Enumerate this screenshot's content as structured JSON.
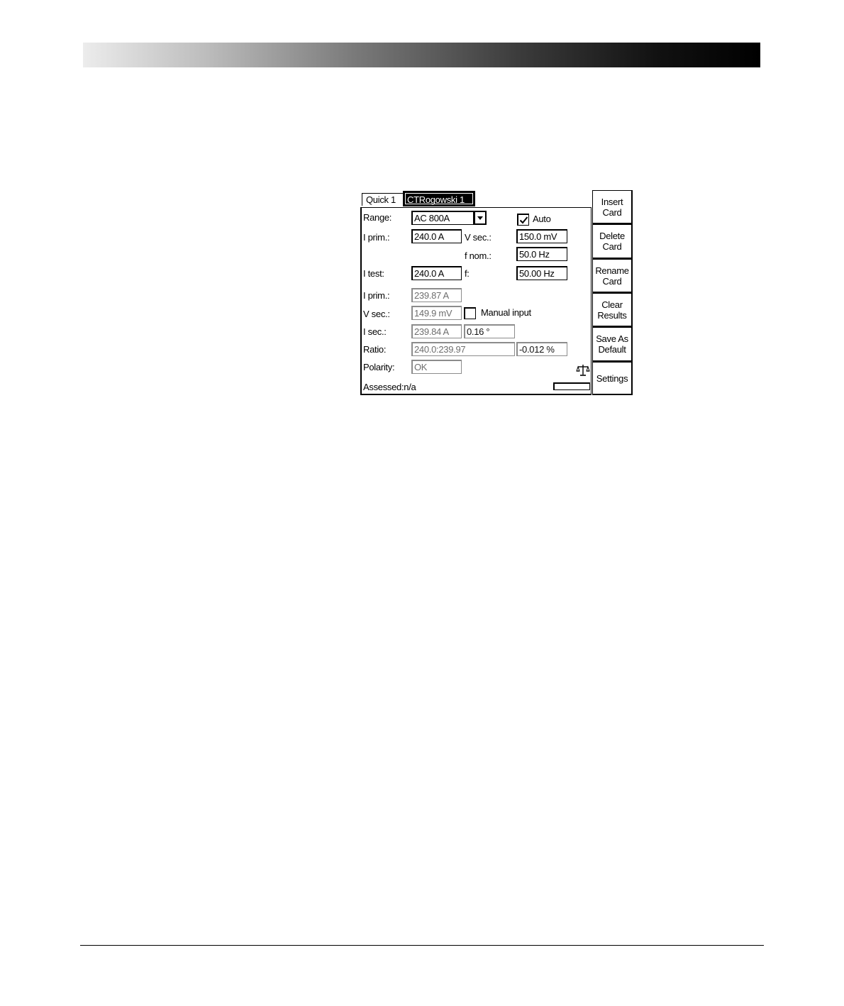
{
  "tabs": [
    {
      "label": "Quick 1",
      "active": false
    },
    {
      "label": "CTRogowski 1",
      "active": true
    }
  ],
  "form": {
    "range_label": "Range:",
    "range_value": "AC 800A",
    "auto_label": "Auto",
    "auto_checked": true,
    "iprim_label": "I prim.:",
    "iprim_value": "240.0 A",
    "vsec_label": "V sec.:",
    "vsec_value": "150.0 mV",
    "fnom_label": "f nom.:",
    "fnom_value": "50.0 Hz",
    "itest_label": "I test:",
    "itest_value": "240.0 A",
    "f_label": "f:",
    "f_value": "50.00 Hz"
  },
  "results": {
    "iprim_label": "I prim.:",
    "iprim_value": "239.87 A",
    "vsec_label": "V sec.:",
    "vsec_value": "149.9 mV",
    "manual_label": "Manual input",
    "manual_checked": false,
    "isec_label": "I sec.:",
    "isec_value": "239.84 A",
    "isec_phase": "0.16 °",
    "ratio_label": "Ratio:",
    "ratio_value": "240.0:239.97",
    "ratio_error": "-0.012 %",
    "polarity_label": "Polarity:",
    "polarity_value": "OK",
    "assessed_label": "Assessed:n/a",
    "scale_icon": "scale-icon"
  },
  "side_buttons": [
    {
      "label": "Insert\nCard"
    },
    {
      "label": "Delete\nCard"
    },
    {
      "label": "Rename\nCard"
    },
    {
      "label": "Clear\nResults"
    },
    {
      "label": "Save As\nDefault"
    },
    {
      "label": "Settings"
    }
  ]
}
